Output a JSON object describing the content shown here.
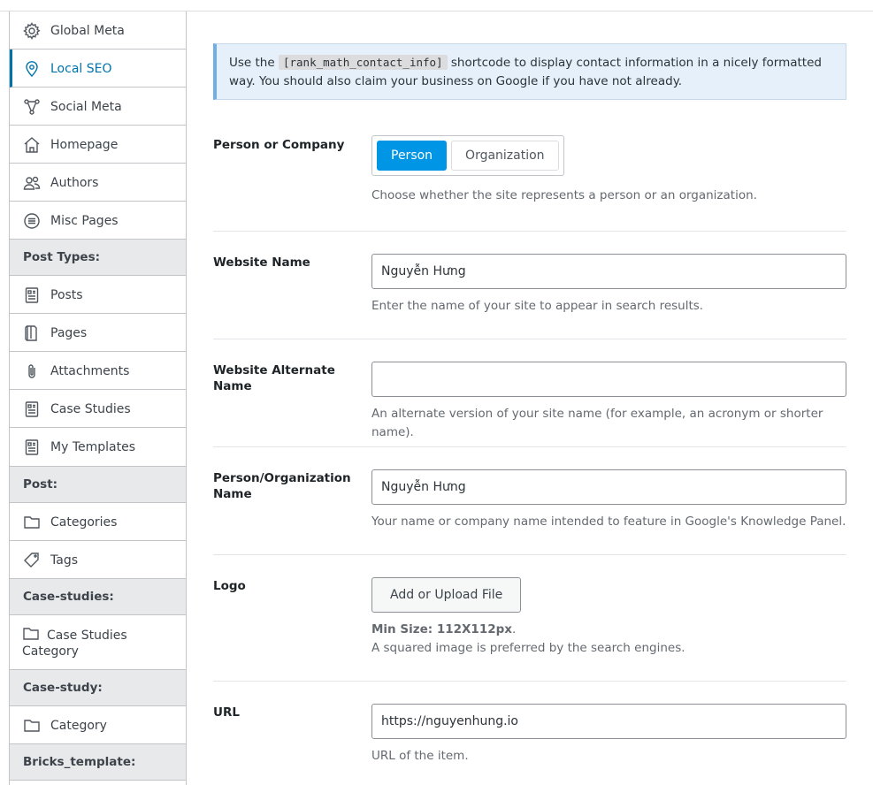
{
  "sidebar": {
    "items": [
      {
        "label": "Global Meta",
        "icon": "gear-icon"
      },
      {
        "label": "Local SEO",
        "icon": "location-pin-icon"
      },
      {
        "label": "Social Meta",
        "icon": "share-network-icon"
      },
      {
        "label": "Homepage",
        "icon": "home-icon"
      },
      {
        "label": "Authors",
        "icon": "users-icon"
      },
      {
        "label": "Misc Pages",
        "icon": "list-circle-icon"
      }
    ],
    "post_types_header": "Post Types:",
    "post_types": [
      {
        "label": "Posts",
        "icon": "document-icon"
      },
      {
        "label": "Pages",
        "icon": "page-icon"
      },
      {
        "label": "Attachments",
        "icon": "paperclip-icon"
      },
      {
        "label": "Case Studies",
        "icon": "document-icon"
      },
      {
        "label": "My Templates",
        "icon": "document-icon"
      }
    ],
    "post_header": "Post:",
    "post_items": [
      {
        "label": "Categories",
        "icon": "folder-icon"
      },
      {
        "label": "Tags",
        "icon": "tag-icon"
      }
    ],
    "case_studies_header": "Case-studies:",
    "case_studies_items": [
      {
        "label": "Case Studies Category",
        "icon": "folder-icon"
      }
    ],
    "case_study_header": "Case-study:",
    "case_study_items": [
      {
        "label": "Category",
        "icon": "folder-icon"
      }
    ],
    "bricks_header": "Bricks_template:"
  },
  "notice": {
    "prefix": "Use the",
    "shortcode": "[rank_math_contact_info]",
    "suffix": "shortcode to display contact information in a nicely formatted way. You should also claim your business on Google if you have not already."
  },
  "fields": {
    "person_company": {
      "label": "Person or Company",
      "options": [
        "Person",
        "Organization"
      ],
      "selected": "Person",
      "desc": "Choose whether the site represents a person or an organization."
    },
    "website_name": {
      "label": "Website Name",
      "value": "Nguyễn Hưng",
      "desc": "Enter the name of your site to appear in search results."
    },
    "website_alt_name": {
      "label": "Website Alternate Name",
      "value": "",
      "desc": "An alternate version of your site name (for example, an acronym or shorter name)."
    },
    "org_name": {
      "label": "Person/Organization Name",
      "value": "Nguyễn Hưng",
      "desc": "Your name or company name intended to feature in Google's Knowledge Panel."
    },
    "logo": {
      "label": "Logo",
      "button": "Add or Upload File",
      "min_size": "Min Size: 112X112px",
      "min_size_suffix": ".",
      "desc": "A squared image is preferred by the search engines."
    },
    "url": {
      "label": "URL",
      "value": "https://nguyenhung.io",
      "desc": "URL of the item."
    }
  },
  "colors": {
    "accent": "#0073aa",
    "toggle_selected": "#0095e5",
    "notice_border": "#72aee6"
  }
}
